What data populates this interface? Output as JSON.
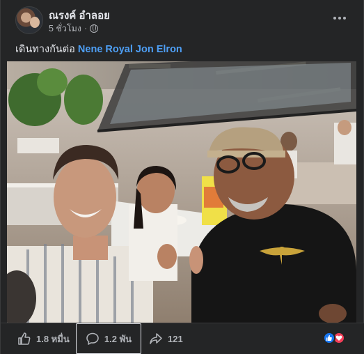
{
  "post": {
    "author": "ณรงค์ อำลอย",
    "time": "5 ชั่วโมง",
    "separator": "·",
    "caption_prefix": "เดินทางกันต่อ ",
    "tagged": "Nene Royal Jon Elron"
  },
  "actions": {
    "like_count": "1.8 หมื่น",
    "comment_count": "1.2 พัน",
    "share_count": "121"
  },
  "icons": {
    "more": "more-options-icon",
    "privacy": "globe-icon",
    "like": "thumbs-up-icon",
    "comment": "comment-bubble-icon",
    "share": "share-arrow-icon",
    "reactions": [
      "like-reaction-icon",
      "love-reaction-icon"
    ]
  },
  "colors": {
    "background": "#242526",
    "link": "#4e9ff5",
    "like_reaction": "#1877f2",
    "love_reaction": "#f33e58"
  }
}
